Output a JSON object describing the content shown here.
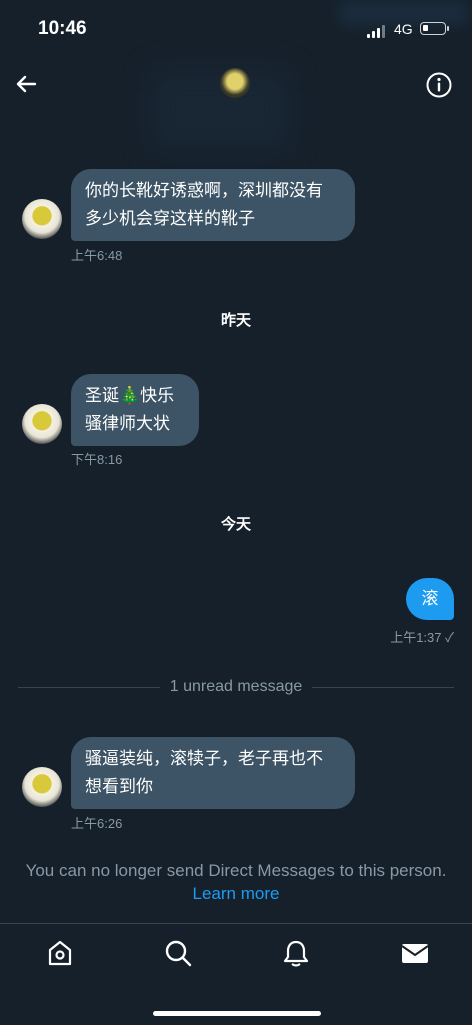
{
  "status_bar": {
    "time": "10:46",
    "network": "4G"
  },
  "messages": [
    {
      "text_line1": "你的长靴好诱惑啊，深圳都没有",
      "text_line2": "多少机会穿这样的靴子",
      "time": "上午6:48"
    },
    {
      "text_line1": "圣诞🎄快乐",
      "text_line2": "骚律师大状",
      "time": "下午8:16"
    },
    {
      "text_line1": "骚逼装纯，滚犊子，老子再也不",
      "text_line2": "想看到你",
      "time": "上午6:26"
    }
  ],
  "day_separators": {
    "yesterday": "昨天",
    "today": "今天"
  },
  "sent_message": {
    "text": "滚",
    "time": "上午1:37 ✓"
  },
  "unread_divider": "1 unread message",
  "notice": {
    "text": "You can no longer send Direct Messages to this person.",
    "link": "Learn more"
  },
  "colors": {
    "background": "#15202b",
    "bubble_received": "#3d5466",
    "bubble_sent": "#1d9bf0",
    "muted": "#8899a6"
  }
}
